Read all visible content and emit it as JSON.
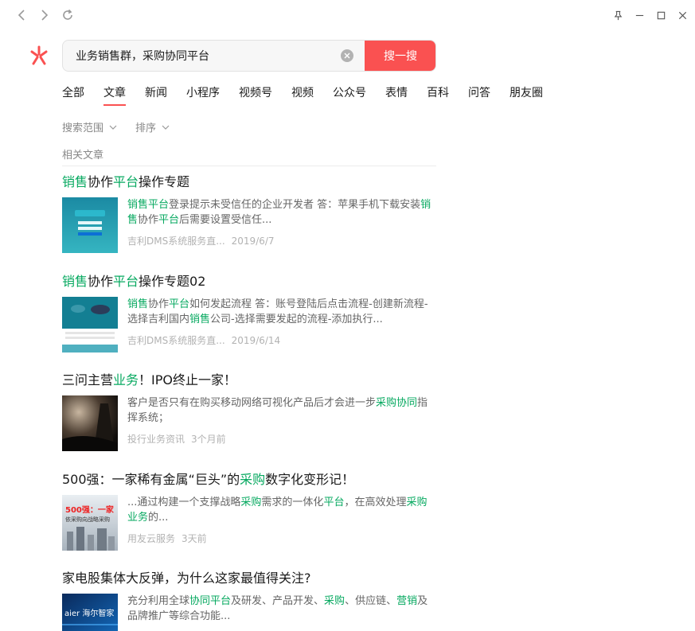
{
  "search": {
    "query": "业务销售群，采购协同平台",
    "button_label": "搜一搜"
  },
  "tabs": [
    "全部",
    "文章",
    "新闻",
    "小程序",
    "视频号",
    "视频",
    "公众号",
    "表情",
    "百科",
    "问答",
    "朋友圈"
  ],
  "active_tab": "文章",
  "filters": {
    "scope_label": "搜索范围",
    "sort_label": "排序"
  },
  "section_title": "相关文章",
  "results": [
    {
      "title": [
        [
          "销售",
          true
        ],
        [
          "协作",
          false
        ],
        [
          "平台",
          true
        ],
        [
          "操作专题",
          false
        ]
      ],
      "snippet": [
        [
          "销售平台",
          true
        ],
        [
          "登录提示未受信任的企业开发者 答：苹果手机下载安装",
          false
        ],
        [
          "销售",
          true
        ],
        [
          "协作",
          false
        ],
        [
          "平台",
          true
        ],
        [
          "后需要设置受信任...",
          false
        ]
      ],
      "source": "吉利DMS系统服务直...",
      "time": "2019/6/7"
    },
    {
      "title": [
        [
          "销售",
          true
        ],
        [
          "协作",
          false
        ],
        [
          "平台",
          true
        ],
        [
          "操作专题02",
          false
        ]
      ],
      "snippet": [
        [
          "销售",
          true
        ],
        [
          "协作",
          false
        ],
        [
          "平台",
          true
        ],
        [
          "如何发起流程 答：账号登陆后点击流程-创建新流程-选择吉利国内",
          false
        ],
        [
          "销售",
          true
        ],
        [
          "公司-选择需要发起的流程-添加执行...",
          false
        ]
      ],
      "source": "吉利DMS系统服务直...",
      "time": "2019/6/14"
    },
    {
      "title": [
        [
          "三问主营",
          false
        ],
        [
          "业务",
          true
        ],
        [
          "！IPO终止一家！",
          false
        ]
      ],
      "snippet": [
        [
          "客户是否只有在购买移动网络可视化产品后才会进一步",
          false
        ],
        [
          "采购协同",
          true
        ],
        [
          "指挥系统；",
          false
        ]
      ],
      "source": "投行业务资讯",
      "time": "3个月前"
    },
    {
      "title": [
        [
          "500强：一家稀有金属“巨头”的",
          false
        ],
        [
          "采购",
          true
        ],
        [
          "数字化变形记！",
          false
        ]
      ],
      "snippet": [
        [
          "...通过构建一个支撑战略",
          false
        ],
        [
          "采购",
          true
        ],
        [
          "需求的一体化",
          false
        ],
        [
          "平台",
          true
        ],
        [
          "，在高效处理",
          false
        ],
        [
          "采购业务",
          true
        ],
        [
          "的...",
          false
        ]
      ],
      "source": "用友云服务",
      "time": "3天前"
    },
    {
      "title": [
        [
          "家电股集体大反弹，为什么这家最值得关注?",
          false
        ]
      ],
      "snippet": [
        [
          "充分利用全球",
          false
        ],
        [
          "协同平台",
          true
        ],
        [
          "及研发、产品开发、",
          false
        ],
        [
          "采购",
          true
        ],
        [
          "、供应链、",
          false
        ],
        [
          "营销",
          true
        ],
        [
          "及品牌推广等综合功能...",
          false
        ]
      ],
      "source": "",
      "time": ""
    }
  ],
  "thumb_texts": {
    "r4": "500强：一家",
    "r4b": "依采购向战略采购",
    "r5": "aier 海尔智家"
  },
  "colors": {
    "accent": "#fa5151",
    "highlight": "#07a960",
    "muted": "#888888"
  }
}
